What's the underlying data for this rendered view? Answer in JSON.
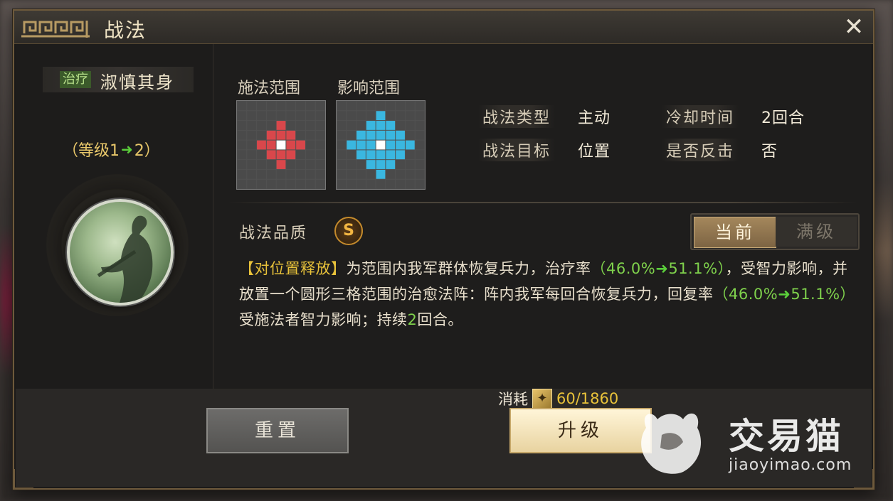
{
  "window": {
    "title": "战法",
    "close_icon": "close-icon"
  },
  "skill": {
    "tag": "治疗",
    "name": "淑慎其身",
    "level_prefix": "（等级1",
    "level_arrow": "➜",
    "level_suffix": "2）"
  },
  "ranges": {
    "cast_label": "施法范围",
    "effect_label": "影响范围",
    "cast_color": "#d9474b",
    "effect_color": "#3ab7e0"
  },
  "attributes": {
    "type_label": "战法类型",
    "type_value": "主动",
    "cooldown_label": "冷却时间",
    "cooldown_value": "2回合",
    "target_label": "战法目标",
    "target_value": "位置",
    "counter_label": "是否反击",
    "counter_value": "否"
  },
  "quality": {
    "label": "战法品质",
    "grade": "S"
  },
  "toggle": {
    "current": "当前",
    "max": "满级"
  },
  "description": {
    "part1": "【对位置释放】",
    "part2": "为范围内我军群体恢复兵力，治疗率",
    "rate1_from": "（46.0%",
    "arrow": "➜",
    "rate1_to": "51.1%）",
    "part3": "，受智力影响，并放置一个圆形三格范围的治愈法阵：阵内我军每回合恢复兵力，回复率",
    "rate2_from": "（46.0%",
    "rate2_to": "51.1%）",
    "part4": "受施法者智力影响；持续",
    "duration": "2",
    "part5": "回合。"
  },
  "footer": {
    "reset_label": "重置",
    "upgrade_label": "升级",
    "cost_label": "消耗",
    "cost_value": "60/1860"
  },
  "watermark": {
    "name": "交易猫",
    "url": "jiaoyimao.com"
  }
}
